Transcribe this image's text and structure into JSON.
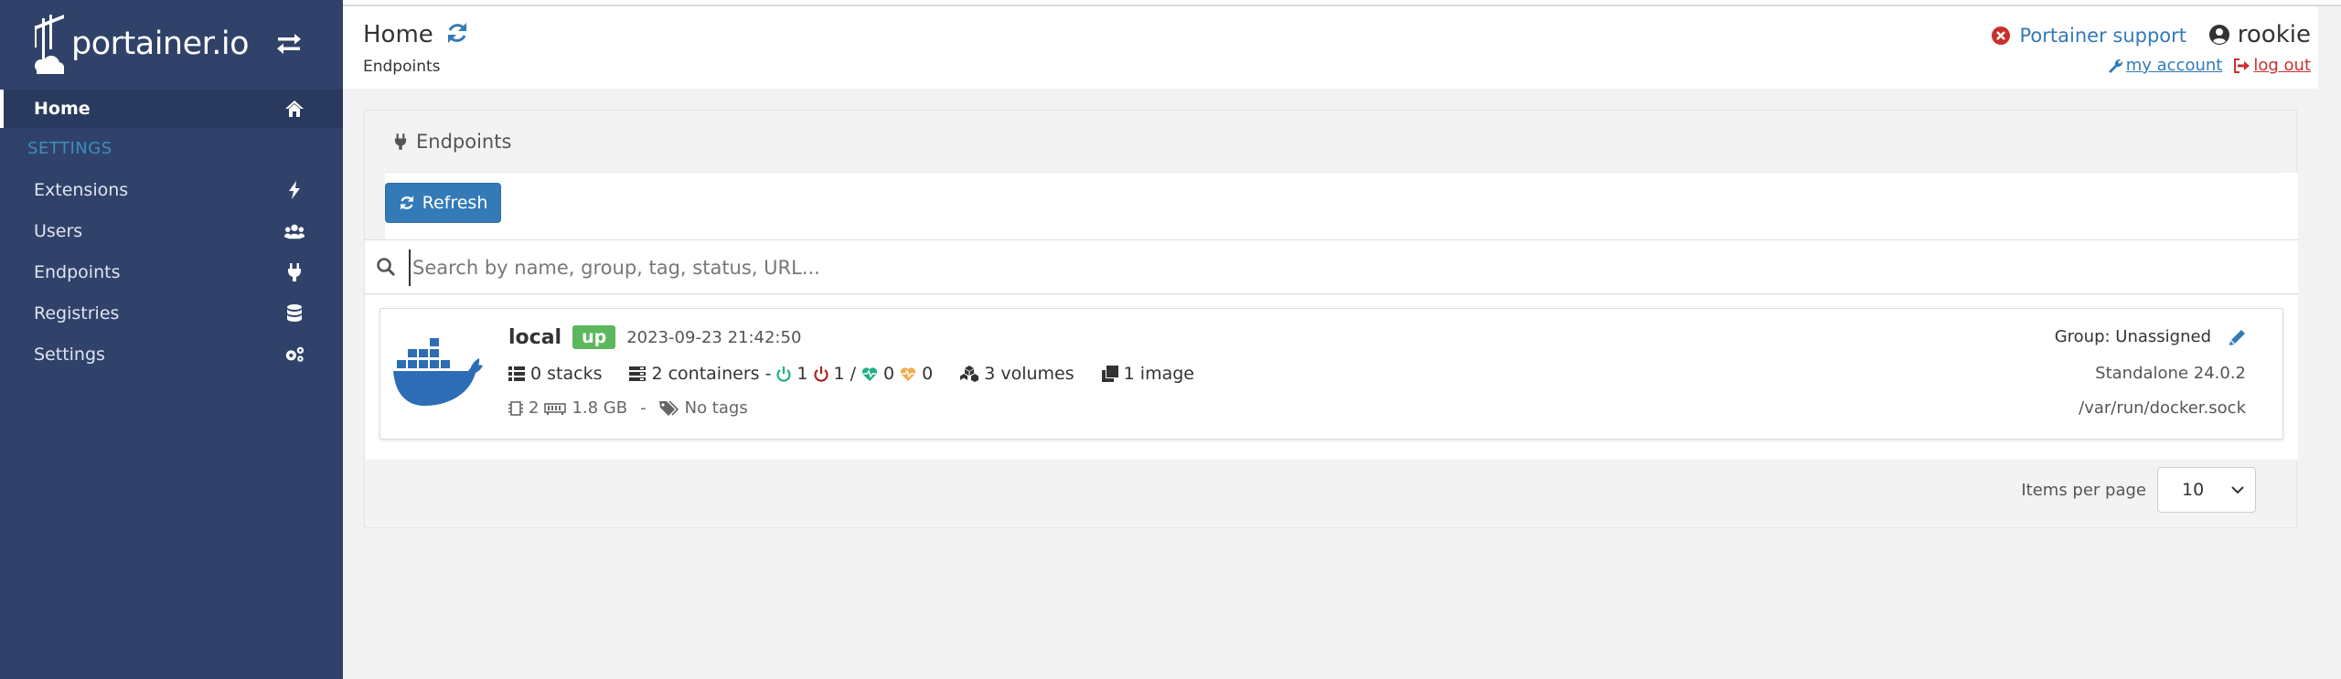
{
  "sidebar": {
    "brand": "portainer.io",
    "home_label": "Home",
    "section_label": "SETTINGS",
    "items": [
      {
        "label": "Extensions",
        "icon": "bolt-icon"
      },
      {
        "label": "Users",
        "icon": "users-icon"
      },
      {
        "label": "Endpoints",
        "icon": "plug-icon"
      },
      {
        "label": "Registries",
        "icon": "database-icon"
      },
      {
        "label": "Settings",
        "icon": "cogs-icon"
      }
    ]
  },
  "header": {
    "title": "Home",
    "breadcrumb": "Endpoints",
    "support_label": "Portainer support",
    "username": "rookie",
    "my_account_label": "my account",
    "logout_label": "log out"
  },
  "widget": {
    "title": "Endpoints",
    "refresh_label": "Refresh",
    "search_placeholder": "Search by name, group, tag, status, URL...",
    "items_per_page_label": "Items per page",
    "items_per_page_value": "10"
  },
  "endpoint": {
    "name": "local",
    "status": "up",
    "timestamp": "2023-09-23 21:42:50",
    "stacks": "0 stacks",
    "containers": "2 containers -",
    "running": "1",
    "stopped": "1 /",
    "healthy": "0",
    "unhealthy": "0",
    "volumes": "3 volumes",
    "images": "1 image",
    "cpus": "2",
    "memory": "1.8 GB",
    "separator": "-",
    "tags": "No tags",
    "group": "Group: Unassigned",
    "version": "Standalone 24.0.2",
    "url": "/var/run/docker.sock"
  },
  "colors": {
    "sidebar_bg": "#30426a",
    "accent": "#337ab7",
    "status_up": "#5cb85c",
    "danger": "#c9302c",
    "running": "#23ae89",
    "stopped": "#ae2323",
    "unhealthy": "#f0ad4e"
  }
}
